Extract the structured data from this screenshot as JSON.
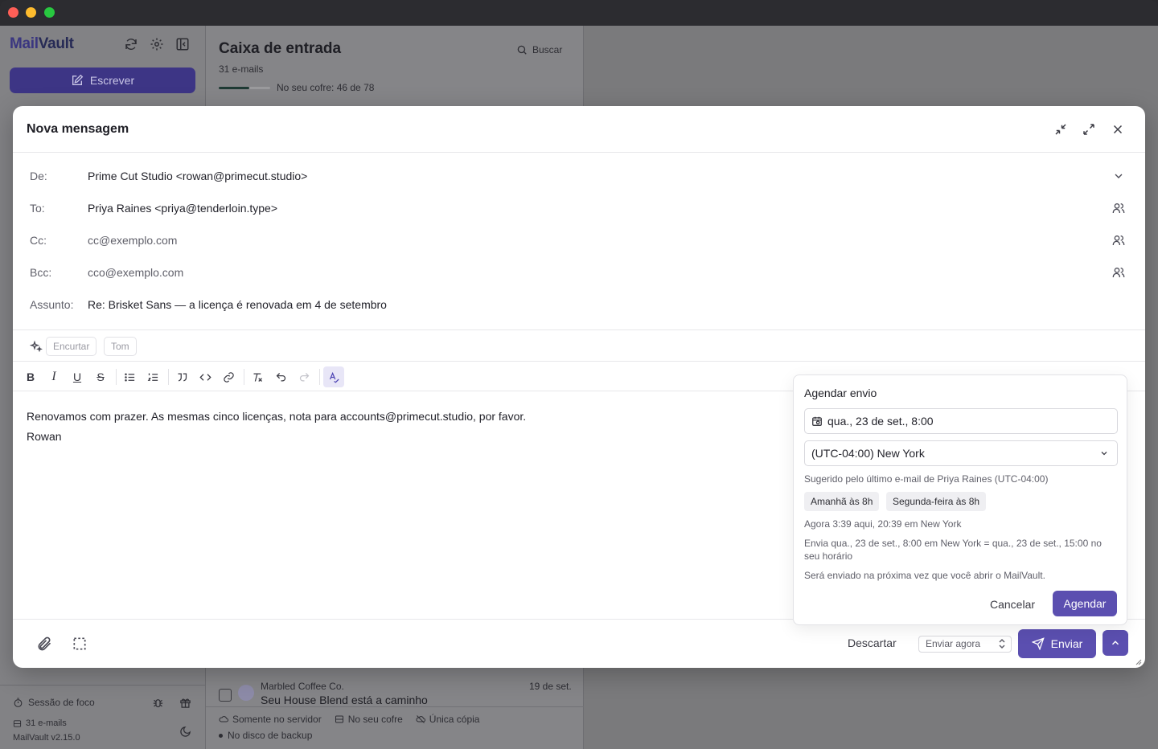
{
  "app": {
    "logo_mail": "Mail",
    "logo_vault": "Vault",
    "compose_label": "Escrever",
    "focus_label": "Sessão de foco",
    "email_count": "31 e-mails",
    "version": "MailVault v2.15.0"
  },
  "inbox": {
    "title": "Caixa de entrada",
    "count": "31 e-mails",
    "vault_status": "No seu cofre: 46 de 78",
    "vault_progress": 0.59,
    "search_label": "Buscar",
    "row": {
      "from": "Marbled Coffee Co.",
      "subject": "Seu House Blend está a caminho",
      "date": "19 de set.",
      "tag_server": "Somente no servidor",
      "tag_vault": "No seu cofre",
      "tag_single": "Única cópia",
      "tag_backup": "No disco de backup"
    }
  },
  "compose": {
    "title": "Nova mensagem",
    "from_label": "De:",
    "from_value": "Prime Cut Studio <rowan@primecut.studio>",
    "to_label": "To:",
    "to_value": "Priya Raines <priya@tenderloin.type>",
    "cc_label": "Cc:",
    "cc_placeholder": "cc@exemplo.com",
    "bcc_label": "Bcc:",
    "bcc_placeholder": "cco@exemplo.com",
    "subject_label": "Assunto:",
    "subject_value": "Re: Brisket Sans — a licença é renovada em 4 de setembro",
    "ai_shorten": "Encurtar",
    "ai_tone": "Tom",
    "body_line1": "Renovamos com prazer. As mesmas cinco licenças, nota para accounts@primecut.studio, por favor.",
    "body_line2": "Rowan",
    "discard_label": "Descartar",
    "send_mode": "Enviar agora",
    "send_label": "Enviar"
  },
  "schedule": {
    "title": "Agendar envio",
    "date_value": "qua., 23 de set., 8:00",
    "timezone": "(UTC-04:00) New York",
    "suggestion": "Sugerido pelo último e-mail de Priya Raines (UTC-04:00)",
    "chip_tomorrow": "Amanhã às 8h",
    "chip_monday": "Segunda-feira às 8h",
    "now_text": "Agora 3:39 aqui, 20:39 em New York",
    "sends_text": "Envia qua., 23 de set., 8:00 em New York = qua., 23 de set., 15:00 no seu horário",
    "note_text": "Será enviado na próxima vez que você abrir o MailVault.",
    "cancel_label": "Cancelar",
    "schedule_label": "Agendar"
  }
}
